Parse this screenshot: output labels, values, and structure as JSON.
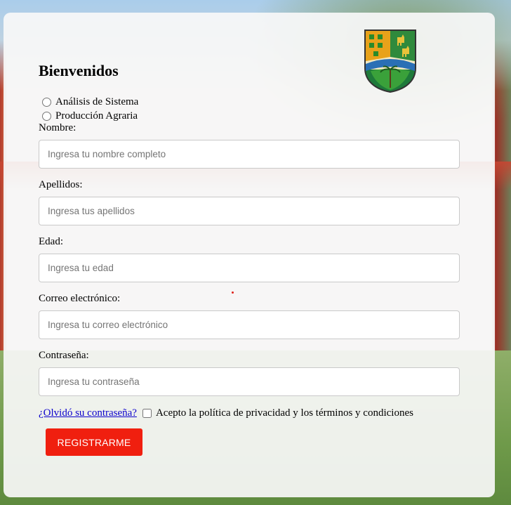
{
  "form": {
    "title": "Bienvenidos",
    "careers": [
      {
        "label": "Análisis de Sistema"
      },
      {
        "label": "Producción Agraria"
      }
    ],
    "fields": {
      "nombre": {
        "label": "Nombre:",
        "placeholder": "Ingresa tu nombre completo",
        "value": ""
      },
      "apellidos": {
        "label": "Apellidos:",
        "placeholder": "Ingresa tus apellidos",
        "value": ""
      },
      "edad": {
        "label": "Edad:",
        "placeholder": "Ingresa tu edad",
        "value": ""
      },
      "correo": {
        "label": "Correo electrónico:",
        "placeholder": "Ingresa tu correo electrónico",
        "value": ""
      },
      "contrasena": {
        "label": "Contraseña:",
        "placeholder": "Ingresa tu contraseña",
        "value": ""
      }
    },
    "forgot_password_link": "¿Olvidó su contraseña?",
    "privacy_checkbox_label": "Acepto la política de privacidad y los términos y condiciones",
    "register_button": "REGISTRARME"
  },
  "logo": {
    "icon": "shield-crest-icon"
  },
  "colors": {
    "primary_button": "#f01f0f",
    "link": "#0b00cc",
    "card_background": "#f8f8f8"
  }
}
